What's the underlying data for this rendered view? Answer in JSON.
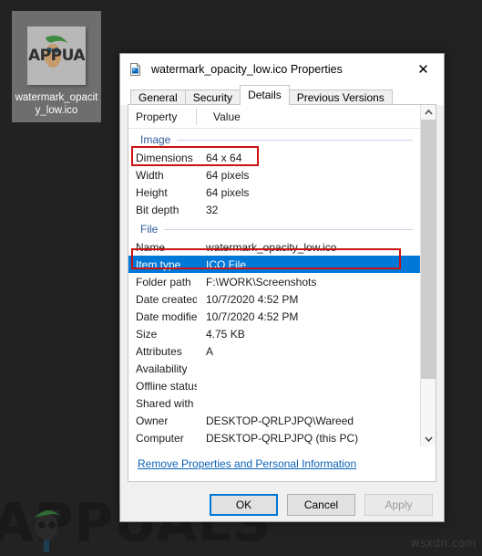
{
  "desktop": {
    "icon": {
      "label": "watermark_opacity_low.ico",
      "thumb_text": "APPUALS",
      "icon_name": "ico-file-thumbnail"
    },
    "watermark": {
      "text": "APPUALS",
      "site": "wsxdn.com"
    }
  },
  "dialog": {
    "title": "watermark_opacity_low.ico Properties",
    "title_icon": "image-file-icon",
    "close_label": "✕",
    "tabs": [
      {
        "label": "General",
        "active": false
      },
      {
        "label": "Security",
        "active": false
      },
      {
        "label": "Details",
        "active": true
      },
      {
        "label": "Previous Versions",
        "active": false
      }
    ],
    "columns": {
      "property": "Property",
      "value": "Value"
    },
    "sections": [
      {
        "name": "Image",
        "rows": [
          {
            "property": "Dimensions",
            "value": "64 x 64",
            "selected": false,
            "annotated": true
          },
          {
            "property": "Width",
            "value": "64 pixels",
            "selected": false,
            "annotated": false
          },
          {
            "property": "Height",
            "value": "64 pixels",
            "selected": false,
            "annotated": false
          },
          {
            "property": "Bit depth",
            "value": "32",
            "selected": false,
            "annotated": false
          }
        ]
      },
      {
        "name": "File",
        "rows": [
          {
            "property": "Name",
            "value": "watermark_opacity_low.ico",
            "selected": false,
            "annotated": false
          },
          {
            "property": "Item type",
            "value": "ICO File",
            "selected": true,
            "annotated": true
          },
          {
            "property": "Folder path",
            "value": "F:\\WORK\\Screenshots",
            "selected": false,
            "annotated": false
          },
          {
            "property": "Date created",
            "value": "10/7/2020 4:52 PM",
            "selected": false,
            "annotated": false
          },
          {
            "property": "Date modified",
            "value": "10/7/2020 4:52 PM",
            "selected": false,
            "annotated": false
          },
          {
            "property": "Size",
            "value": "4.75 KB",
            "selected": false,
            "annotated": false
          },
          {
            "property": "Attributes",
            "value": "A",
            "selected": false,
            "annotated": false
          },
          {
            "property": "Availability",
            "value": "",
            "selected": false,
            "annotated": false
          },
          {
            "property": "Offline status",
            "value": "",
            "selected": false,
            "annotated": false
          },
          {
            "property": "Shared with",
            "value": "",
            "selected": false,
            "annotated": false
          },
          {
            "property": "Owner",
            "value": "DESKTOP-QRLPJPQ\\Wareed",
            "selected": false,
            "annotated": false
          },
          {
            "property": "Computer",
            "value": "DESKTOP-QRLPJPQ (this PC)",
            "selected": false,
            "annotated": false
          }
        ]
      }
    ],
    "remove_link": "Remove Properties and Personal Information",
    "scrollbar": {
      "up_icon": "chevron-up-icon",
      "down_icon": "chevron-down-icon"
    },
    "buttons": {
      "ok": "OK",
      "cancel": "Cancel",
      "apply": "Apply"
    }
  },
  "colors": {
    "selection_blue": "#0078d7",
    "annotation_red": "#cc1111",
    "section_header_blue": "#2f5c9e",
    "link_blue": "#0b63b8"
  }
}
